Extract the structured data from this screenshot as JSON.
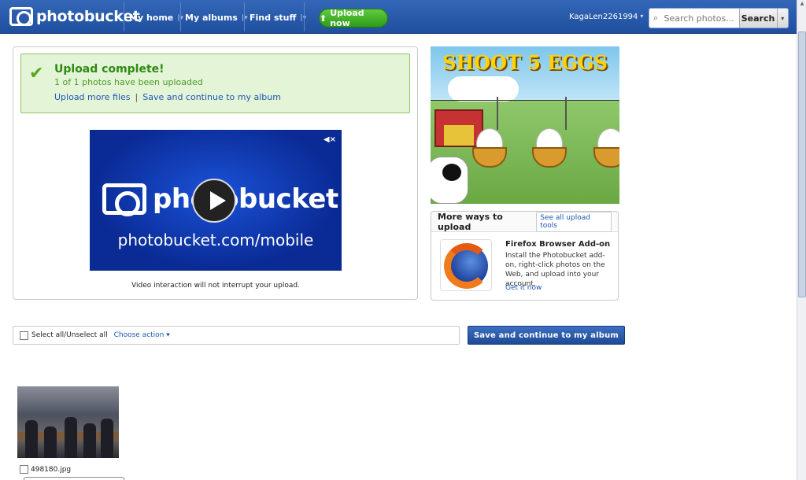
{
  "header": {
    "brand": "photobucket",
    "nav": [
      {
        "label": "My home"
      },
      {
        "label": "My albums"
      },
      {
        "label": "Find stuff"
      }
    ],
    "upload_label": "Upload now",
    "username": "KagaLen2261994",
    "search_placeholder": "Search photos...",
    "search_button": "Search"
  },
  "upload_status": {
    "title": "Upload complete!",
    "subtitle": "1 of 1 photos have been uploaded",
    "link_more": "Upload more files",
    "link_save": "Save and continue to my album"
  },
  "video": {
    "brand": "photobucket",
    "url": "photobucket.com/mobile",
    "note": "Video interaction will not interrupt your upload."
  },
  "ad": {
    "title": "SHOOT 5 EGGS"
  },
  "more_ways": {
    "title": "More ways to upload",
    "link": "See all upload tools",
    "item_title": "Firefox Browser Add-on",
    "item_desc": "Install the Photobucket add-on, right-click photos on the Web, and upload into your account.",
    "item_link": "Get it now"
  },
  "actions": {
    "select_all": "Select all/Unselect all",
    "choose_action": "Choose action",
    "save_button": "Save and continue to my album"
  },
  "photos": [
    {
      "filename": "498180.jpg"
    }
  ],
  "colors": {
    "header_blue": "#1f4f9e",
    "upload_green": "#2e9a1a",
    "success_bg": "#e4f4d6",
    "link_blue": "#1d58b4"
  }
}
